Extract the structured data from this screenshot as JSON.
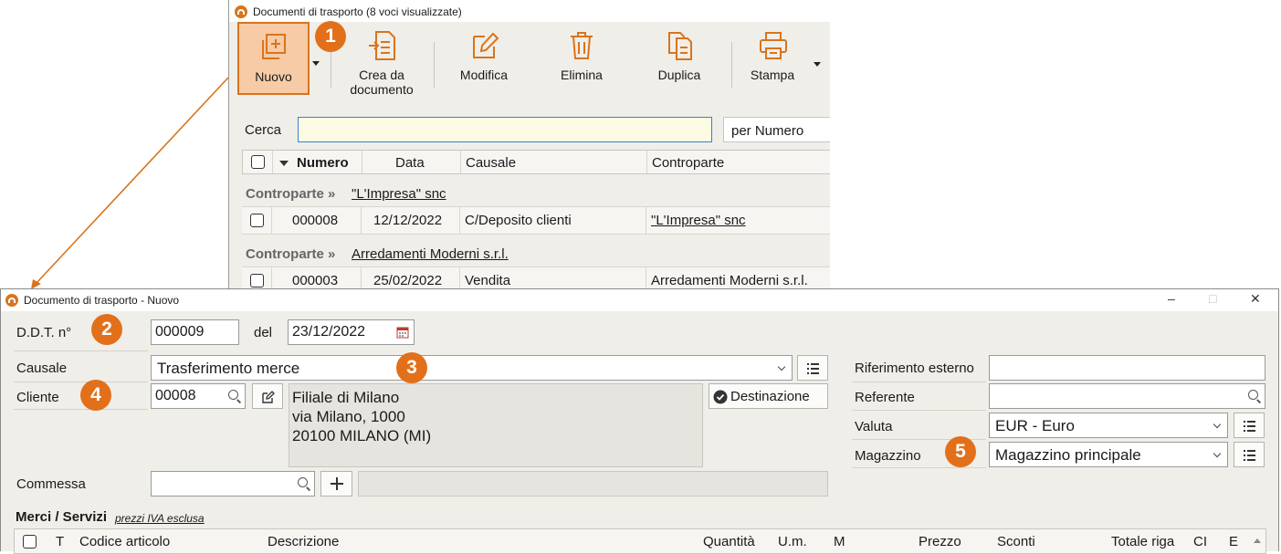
{
  "list_window": {
    "title": "Documenti di trasporto (8 voci visualizzate)",
    "toolbar": {
      "nuovo": "Nuovo",
      "crea_line1": "Crea da",
      "crea_line2": "documento",
      "modifica": "Modifica",
      "elimina": "Elimina",
      "duplica": "Duplica",
      "stampa": "Stampa"
    },
    "search": {
      "label": "Cerca",
      "value": "",
      "mode": "per Numero"
    },
    "columns": {
      "numero": "Numero",
      "data": "Data",
      "causale": "Causale",
      "controparte": "Controparte"
    },
    "groups": [
      {
        "label": "Controparte »",
        "value": "\"L'Impresa\" snc",
        "rows": [
          {
            "numero": "000008",
            "data": "12/12/2022",
            "causale": "C/Deposito clienti",
            "controparte": "\"L'Impresa\" snc"
          }
        ]
      },
      {
        "label": "Controparte »",
        "value": "Arredamenti Moderni s.r.l.",
        "rows": [
          {
            "numero": "000003",
            "data": "25/02/2022",
            "causale": "Vendita",
            "controparte": "Arredamenti Moderni s.r.l."
          }
        ]
      }
    ]
  },
  "form_window": {
    "title": "Documento di trasporto - Nuovo",
    "controls": {
      "minimize": "–",
      "maximize": "□",
      "close": "✕"
    },
    "ddt_label": "D.D.T. n°",
    "ddt_number": "000009",
    "del_label": "del",
    "date": "23/12/2022",
    "causale_label": "Causale",
    "causale_value": "Trasferimento merce",
    "cliente_label": "Cliente",
    "cliente_code": "00008",
    "address": [
      "Filiale di Milano",
      "via Milano, 1000",
      "20100 MILANO (MI)"
    ],
    "destinazione": "Destinazione",
    "commessa_label": "Commessa",
    "commessa_value": "",
    "rif_esterno_label": "Riferimento esterno",
    "rif_esterno_value": "",
    "referente_label": "Referente",
    "referente_value": "",
    "valuta_label": "Valuta",
    "valuta_value": "EUR - Euro",
    "magazzino_label": "Magazzino",
    "magazzino_value": "Magazzino principale",
    "merci_title": "Merci / Servizi",
    "merci_sub": "prezzi IVA esclusa",
    "grid_columns": {
      "t": "T",
      "codice": "Codice articolo",
      "descrizione": "Descrizione",
      "quantita": "Quantità",
      "um": "U.m.",
      "m": "M",
      "prezzo": "Prezzo",
      "sconti": "Sconti",
      "totale": "Totale riga",
      "ci": "CI",
      "e": "E"
    }
  },
  "callouts": [
    "1",
    "2",
    "3",
    "4",
    "5"
  ],
  "colors": {
    "accent": "#e2701a",
    "accent_light": "#f6cba6",
    "window_bg": "#f0eee9"
  }
}
